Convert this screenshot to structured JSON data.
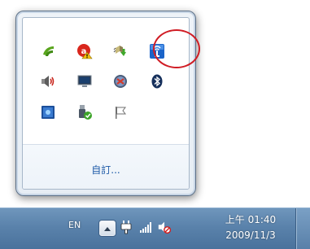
{
  "popup": {
    "customize_label": "自訂...",
    "icons": [
      {
        "name": "nvidia-icon"
      },
      {
        "name": "security-warning-icon"
      },
      {
        "name": "safely-remove-hardware-icon"
      },
      {
        "name": "wireless-network-icon"
      },
      {
        "name": "volume-icon"
      },
      {
        "name": "display-icon"
      },
      {
        "name": "update-icon"
      },
      {
        "name": "bluetooth-icon"
      },
      {
        "name": "blue-app-icon"
      },
      {
        "name": "usb-device-icon"
      },
      {
        "name": "action-center-flag-icon"
      }
    ]
  },
  "taskbar": {
    "language": "EN",
    "clock_time": "上午 01:40",
    "clock_date": "2009/11/3",
    "icons": [
      "up-arrow-icon",
      "power-plug-icon",
      "signal-bars-icon",
      "volume-muted-icon"
    ]
  },
  "colors": {
    "taskbar": "#5a82ab",
    "link": "#1e5aa8",
    "highlight": "#d01c24"
  }
}
